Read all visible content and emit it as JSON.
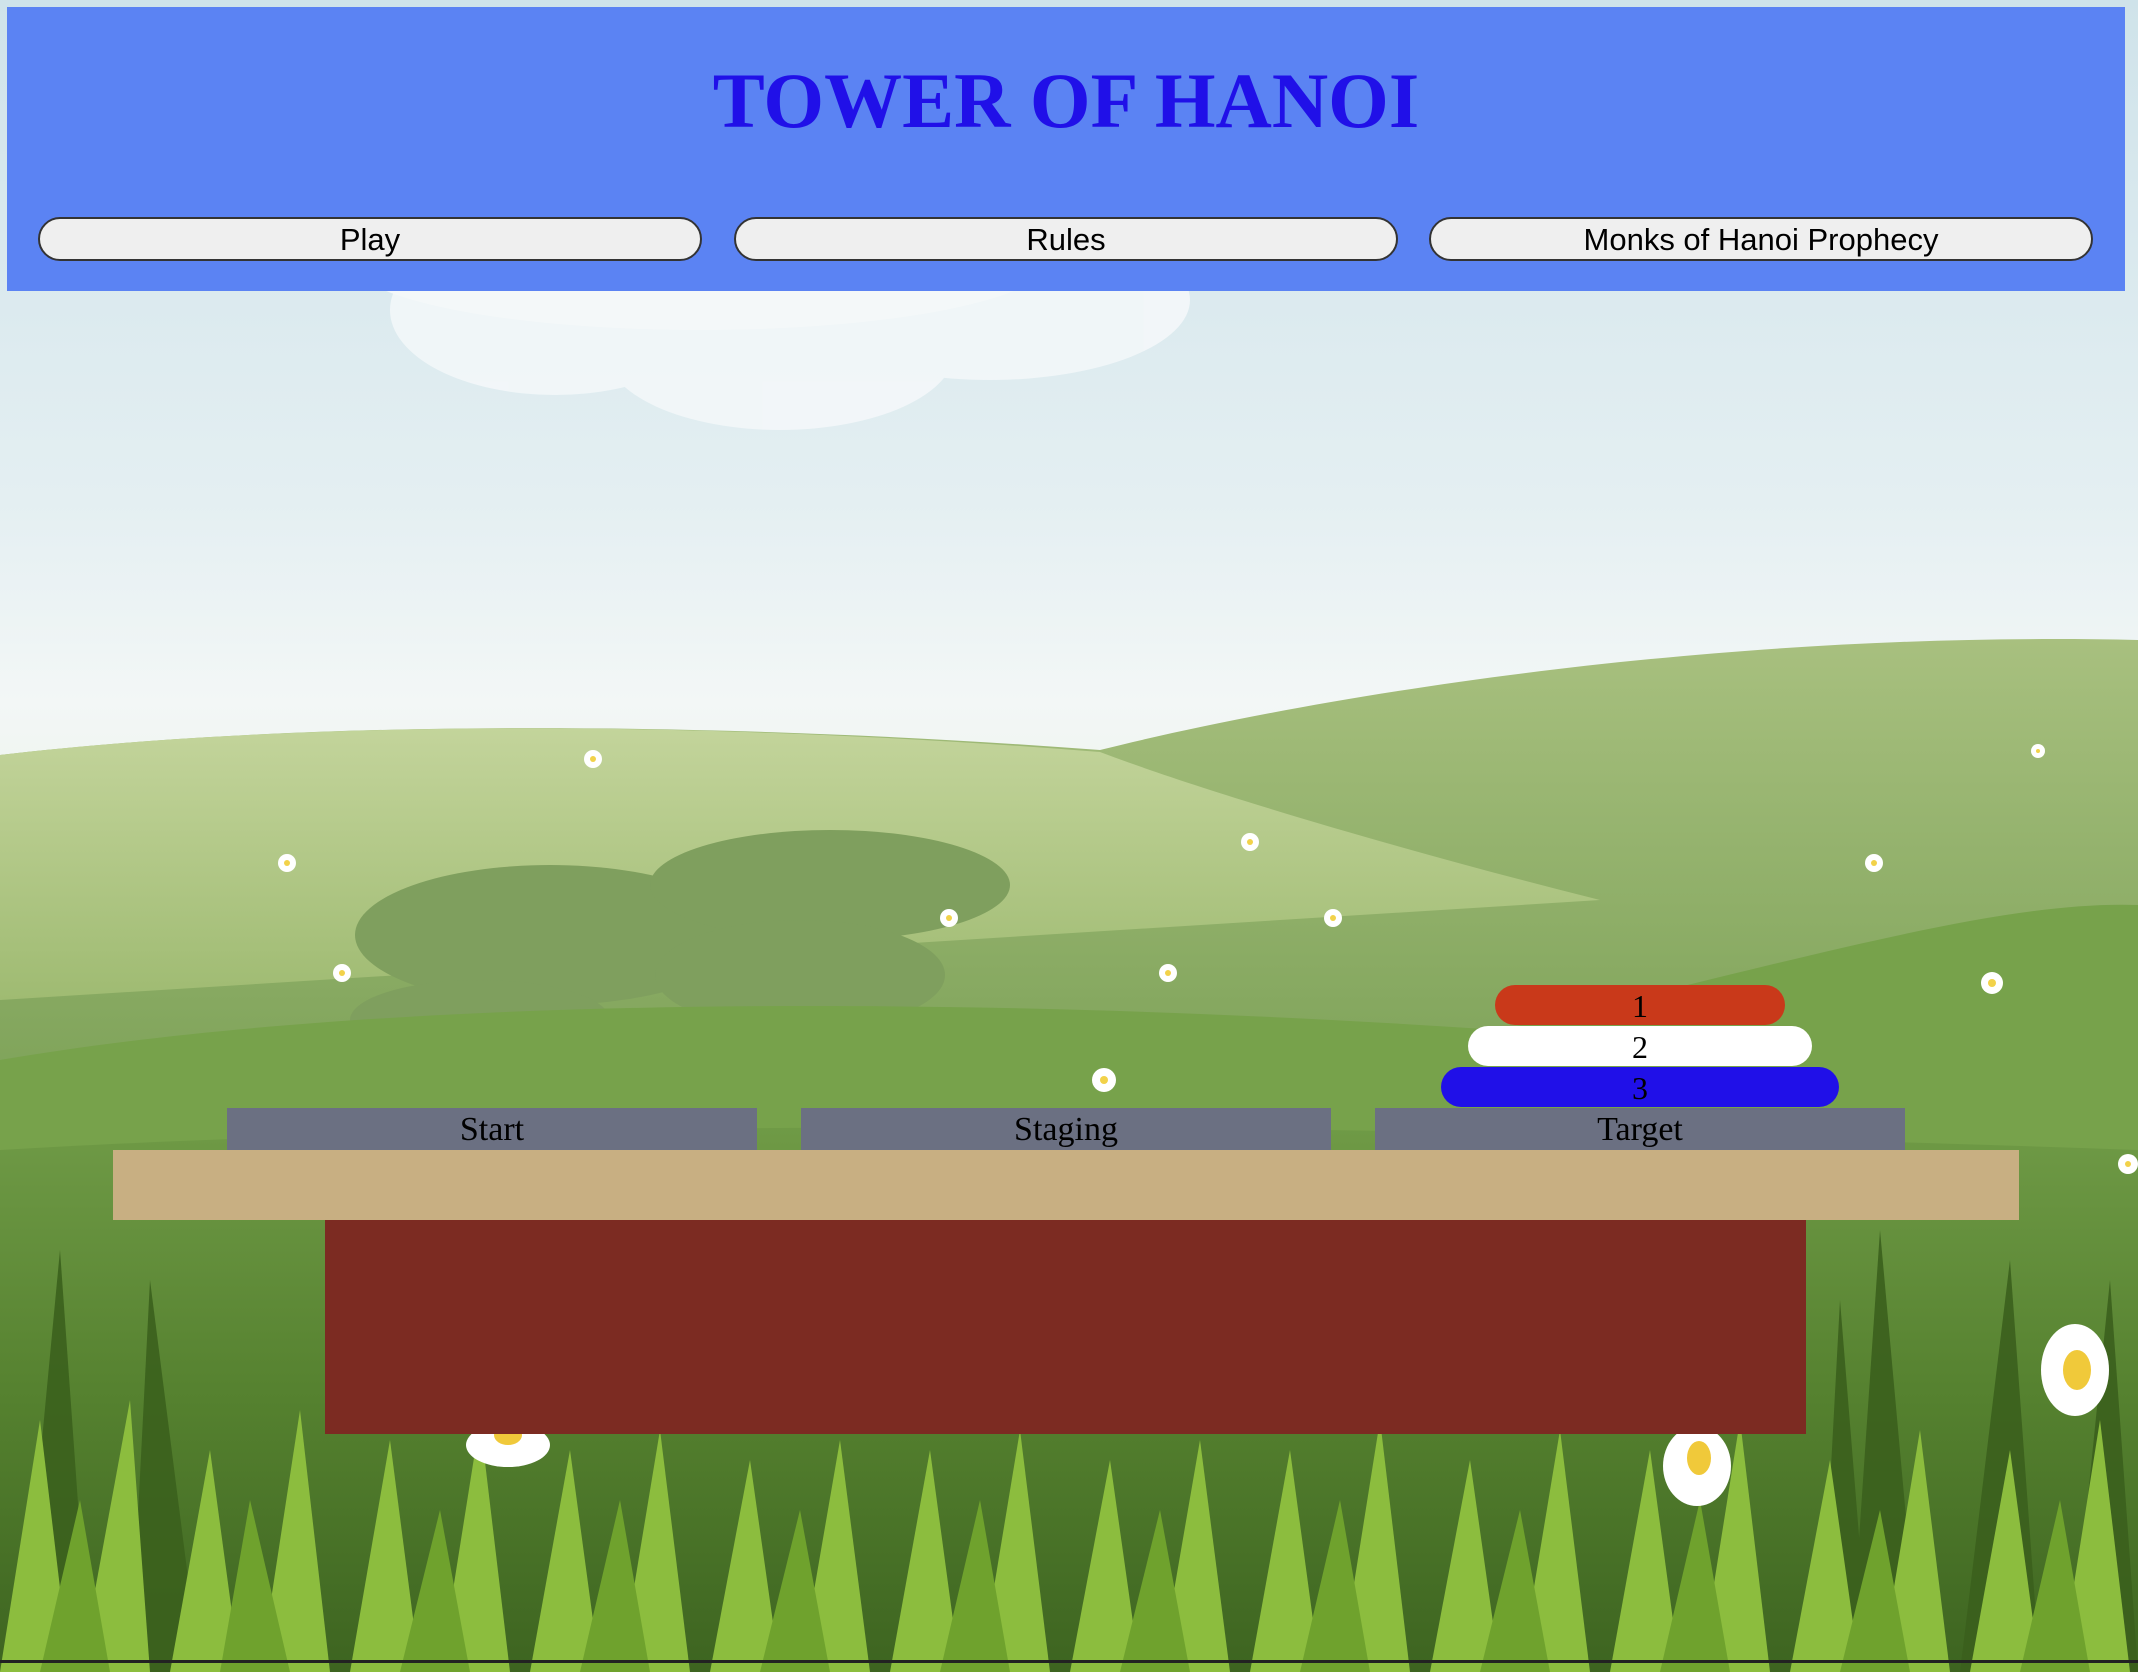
{
  "header": {
    "title": "TOWER OF HANOI",
    "nav": [
      {
        "label": "Play"
      },
      {
        "label": "Rules"
      },
      {
        "label": "Monks of Hanoi Prophecy"
      }
    ]
  },
  "game": {
    "towers": [
      {
        "label": "Start",
        "disks": []
      },
      {
        "label": "Staging",
        "disks": []
      },
      {
        "label": "Target",
        "disks": [
          1,
          2,
          3
        ]
      }
    ],
    "disks": [
      {
        "number": "1",
        "color": "#c9391a"
      },
      {
        "number": "2",
        "color": "#ffffff"
      },
      {
        "number": "3",
        "color": "#2010e8"
      }
    ]
  },
  "colors": {
    "header_bg": "#5b83f3",
    "title": "#2010e8",
    "tower_label_bg": "#6b7082",
    "table_top": "#c8af82",
    "table_base": "#7c2b22"
  }
}
